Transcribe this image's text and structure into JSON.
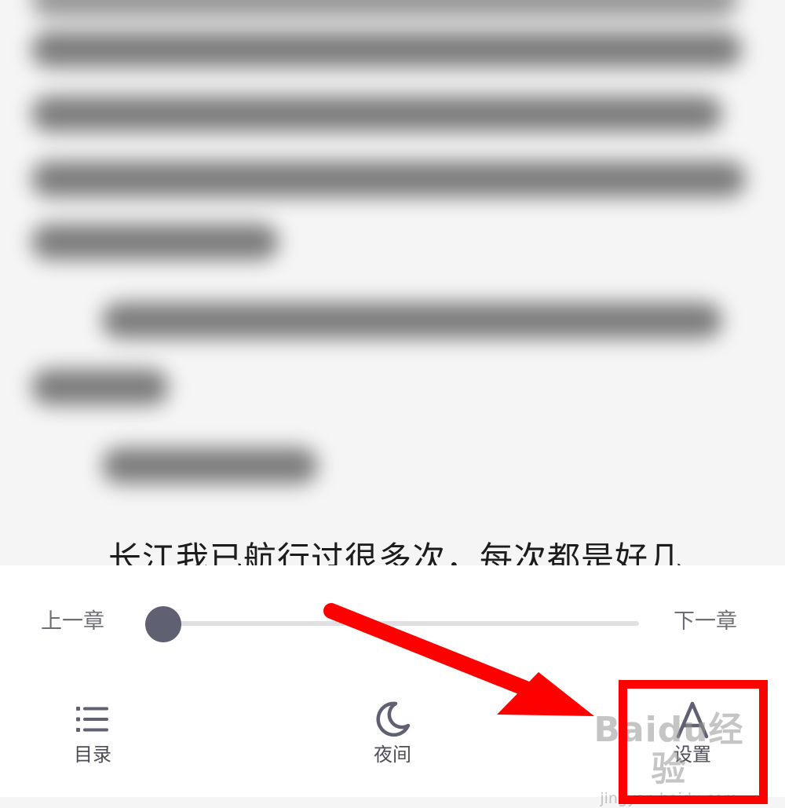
{
  "reader": {
    "visible_text": "长江我已航行过很多次，每次都是好几"
  },
  "menu": {
    "prev_chapter": "上一章",
    "next_chapter": "下一章",
    "progress": 0.0,
    "items": [
      {
        "label": "目录",
        "icon": "list-icon"
      },
      {
        "label": "夜间",
        "icon": "moon-icon"
      },
      {
        "label": "设置",
        "icon": "font-a-icon"
      }
    ]
  },
  "annotation": {
    "highlight_color": "#ff0000",
    "arrow_color": "#ff0000"
  },
  "watermark": {
    "main": "Baidu经验",
    "sub": "jingyan.baidu.com"
  },
  "colors": {
    "thumb": "#5f6173",
    "track": "#e0e0e3",
    "icon": "#5f6173",
    "label": "#4d4d57"
  }
}
